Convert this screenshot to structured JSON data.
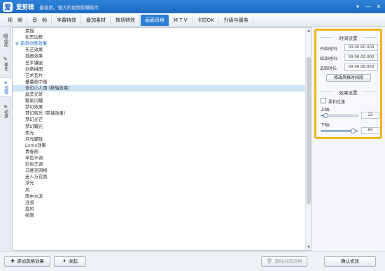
{
  "app": {
    "name": "爱剪辑",
    "slogan": "最易用、强大的视频剪辑软件",
    "logo_text": "爱",
    "window_buttons": [
      "▾",
      "—",
      "✕"
    ]
  },
  "tabs": [
    {
      "label": "视　频"
    },
    {
      "label": "音　频"
    },
    {
      "label": "字幕特效"
    },
    {
      "label": "叠加素材"
    },
    {
      "label": "转场特效"
    },
    {
      "label": "画面风格",
      "active": true
    },
    {
      "label": "M T V"
    },
    {
      "label": "卡拉OK"
    },
    {
      "label": "升级与服务"
    }
  ],
  "left_nav": [
    {
      "label": "画面",
      "icon": "▤"
    },
    {
      "label": "美化",
      "icon": "✎"
    },
    {
      "label": "滤镜",
      "icon": "✦",
      "active": true
    },
    {
      "label": "动景",
      "icon": "≋"
    }
  ],
  "effects_list": [
    {
      "label": "素描"
    },
    {
      "label": "加黑边框"
    },
    {
      "label": "⊖ 新奇创意效果",
      "group": true
    },
    {
      "label": "布艺效果"
    },
    {
      "label": "插画效果"
    },
    {
      "label": "艺术镶嵌"
    },
    {
      "label": "创意拼图"
    },
    {
      "label": "艺术瓦片"
    },
    {
      "label": "垂暮画中画"
    },
    {
      "label": "奇幻小人国 (移轴效果)",
      "selected": true
    },
    {
      "label": "晶莹光斑"
    },
    {
      "label": "繁星闪耀"
    },
    {
      "label": "梦幻效果"
    },
    {
      "label": "梦幻辉光 (梦境效果)"
    },
    {
      "label": "梦幻光芒"
    },
    {
      "label": "梦幻耀光"
    },
    {
      "label": "柔光"
    },
    {
      "label": "月光朦胧"
    },
    {
      "label": "Lomo效果"
    },
    {
      "label": "青春画"
    },
    {
      "label": "单色丰调"
    },
    {
      "label": "彩色丰调"
    },
    {
      "label": "马赛克网格"
    },
    {
      "label": "迷人万花筒"
    },
    {
      "label": "浮光"
    },
    {
      "label": "风"
    },
    {
      "label": "雨中水波"
    },
    {
      "label": "涟漪"
    },
    {
      "label": "旋风"
    },
    {
      "label": "绘画"
    }
  ],
  "panel": {
    "time_title": "时间设置",
    "start_label": "开始时间:",
    "start_value": "00:00:00.000",
    "end_label": "结束时间:",
    "end_value": "00:00:00.000",
    "duration_label": "选取时长:",
    "duration_value": "00:00:00.000",
    "modify_time_button": "修改风格时间段",
    "effect_title": "效果设置",
    "soft_transition_label": "柔和过渡",
    "soft_transition_checked": false,
    "upper_axis_label": "上轴:",
    "upper_axis_value": "15",
    "lower_axis_label": "下轴:",
    "lower_axis_value": "85"
  },
  "bottom": {
    "add_style_button": "添加风格效果",
    "collect_button": "收起",
    "delete_current_button": "删除当前风格",
    "confirm_button": "确认修改"
  },
  "colors": {
    "accent": "#2d7fd4",
    "highlight_border": "#f1b51c",
    "selected_row": "#cde3f8"
  }
}
